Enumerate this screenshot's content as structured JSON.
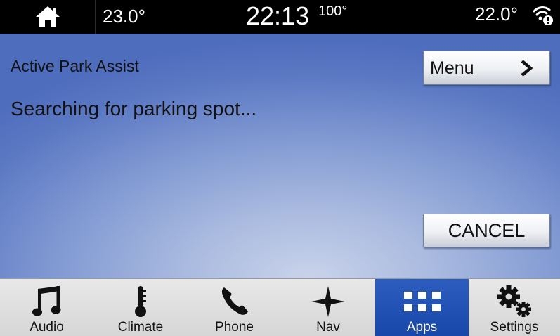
{
  "status_bar": {
    "home_icon": "home-icon",
    "temp_left": "23.0°",
    "clock": "22:13",
    "outside_temp": "100°",
    "temp_right": "22.0°",
    "wifi_icon": "wifi-alert-icon"
  },
  "main": {
    "title": "Active Park Assist",
    "status_message": "Searching for parking spot...",
    "menu_label": "Menu",
    "menu_icon": "chevron-right-icon",
    "cancel_label": "CANCEL"
  },
  "bottom_nav": {
    "tabs": [
      {
        "label": "Audio",
        "icon": "music-note-icon",
        "active": false
      },
      {
        "label": "Climate",
        "icon": "thermometer-icon",
        "active": false
      },
      {
        "label": "Phone",
        "icon": "phone-icon",
        "active": false
      },
      {
        "label": "Nav",
        "icon": "compass-star-icon",
        "active": false
      },
      {
        "label": "Apps",
        "icon": "apps-grid-icon",
        "active": true
      },
      {
        "label": "Settings",
        "icon": "gears-icon",
        "active": false
      }
    ]
  },
  "colors": {
    "active_tab": "#1f50b0",
    "main_background": "#6f8bcb",
    "status_bar": "#000000"
  }
}
